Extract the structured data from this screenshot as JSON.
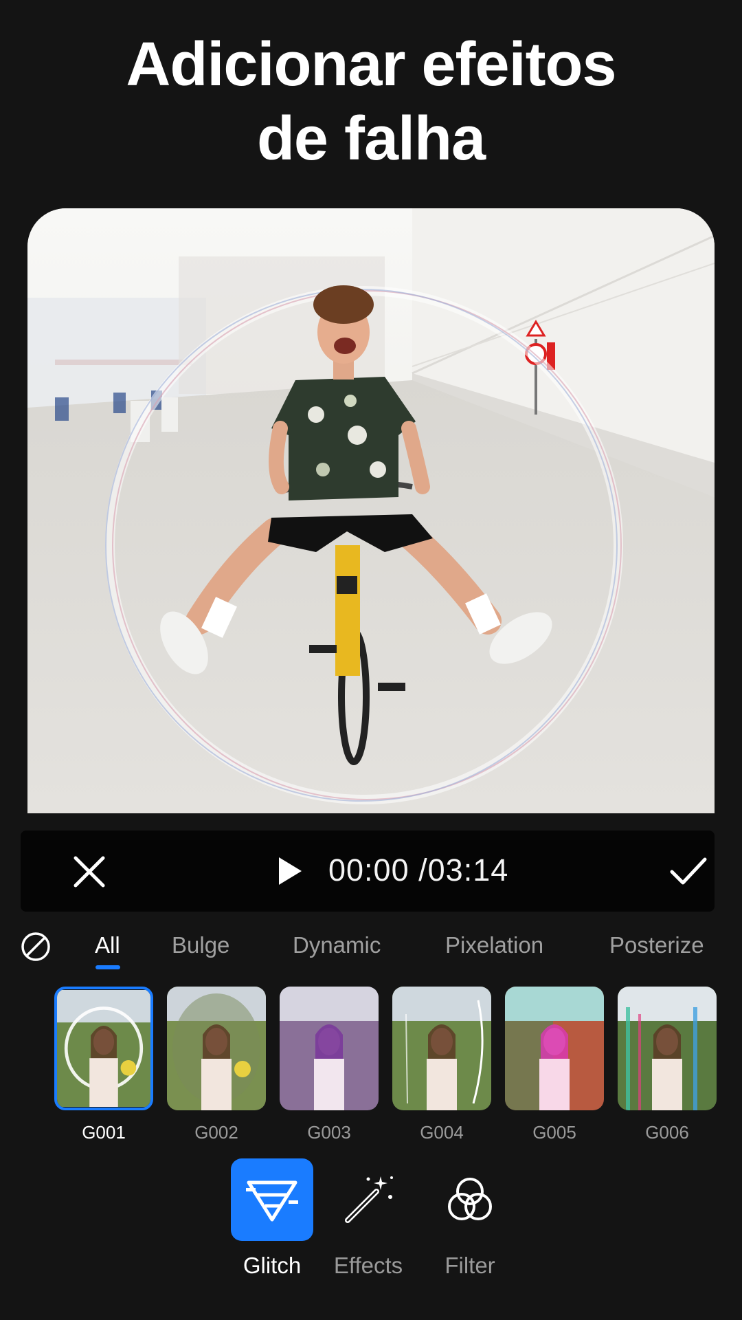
{
  "title": {
    "line1": "Adicionar efeitos",
    "line2": "de falha"
  },
  "player": {
    "current_time": "00:00",
    "separator": " /",
    "total_time": "03:14"
  },
  "tabs": [
    {
      "label": "All",
      "active": true
    },
    {
      "label": "Bulge",
      "active": false
    },
    {
      "label": "Dynamic",
      "active": false
    },
    {
      "label": "Pixelation",
      "active": false
    },
    {
      "label": "Posterize",
      "active": false
    }
  ],
  "thumbnails": [
    {
      "label": "G001",
      "selected": true
    },
    {
      "label": "G002",
      "selected": false
    },
    {
      "label": "G003",
      "selected": false
    },
    {
      "label": "G004",
      "selected": false
    },
    {
      "label": "G005",
      "selected": false
    },
    {
      "label": "G006",
      "selected": false
    }
  ],
  "tools": [
    {
      "label": "Glitch",
      "icon": "glitch-triangle-icon",
      "active": true
    },
    {
      "label": "Effects",
      "icon": "magic-wand-icon",
      "active": false
    },
    {
      "label": "Filter",
      "icon": "filter-circles-icon",
      "active": false
    }
  ],
  "colors": {
    "background": "#141414",
    "accent": "#1a7cff",
    "player_bar": "#050505"
  }
}
